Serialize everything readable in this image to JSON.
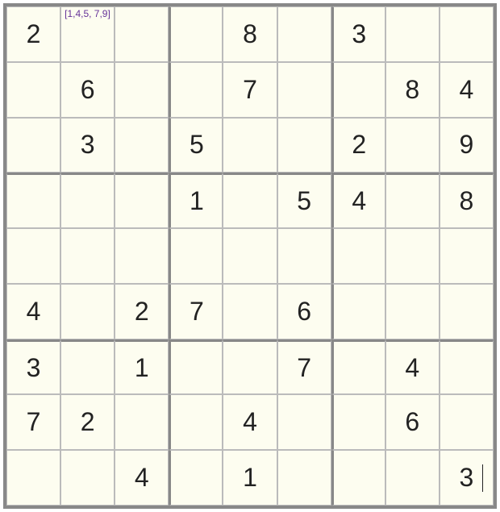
{
  "chart_data": {
    "type": "table",
    "title": "Sudoku Puzzle",
    "grid_size": 9,
    "box_size": 3,
    "rows": [
      [
        {
          "v": "2"
        },
        {
          "hint": "[1,4,5,\n7,9]"
        },
        {
          "v": ""
        },
        {
          "v": ""
        },
        {
          "v": "8"
        },
        {
          "v": ""
        },
        {
          "v": "3"
        },
        {
          "v": ""
        },
        {
          "v": ""
        }
      ],
      [
        {
          "v": ""
        },
        {
          "v": "6"
        },
        {
          "v": ""
        },
        {
          "v": ""
        },
        {
          "v": "7"
        },
        {
          "v": ""
        },
        {
          "v": ""
        },
        {
          "v": "8"
        },
        {
          "v": "4"
        }
      ],
      [
        {
          "v": ""
        },
        {
          "v": "3"
        },
        {
          "v": ""
        },
        {
          "v": "5"
        },
        {
          "v": ""
        },
        {
          "v": ""
        },
        {
          "v": "2"
        },
        {
          "v": ""
        },
        {
          "v": "9"
        }
      ],
      [
        {
          "v": ""
        },
        {
          "v": ""
        },
        {
          "v": ""
        },
        {
          "v": "1"
        },
        {
          "v": ""
        },
        {
          "v": "5"
        },
        {
          "v": "4"
        },
        {
          "v": ""
        },
        {
          "v": "8"
        }
      ],
      [
        {
          "v": ""
        },
        {
          "v": ""
        },
        {
          "v": ""
        },
        {
          "v": ""
        },
        {
          "v": ""
        },
        {
          "v": ""
        },
        {
          "v": ""
        },
        {
          "v": ""
        },
        {
          "v": ""
        }
      ],
      [
        {
          "v": "4"
        },
        {
          "v": ""
        },
        {
          "v": "2"
        },
        {
          "v": "7"
        },
        {
          "v": ""
        },
        {
          "v": "6"
        },
        {
          "v": ""
        },
        {
          "v": ""
        },
        {
          "v": ""
        }
      ],
      [
        {
          "v": "3"
        },
        {
          "v": ""
        },
        {
          "v": "1"
        },
        {
          "v": ""
        },
        {
          "v": ""
        },
        {
          "v": "7"
        },
        {
          "v": ""
        },
        {
          "v": "4"
        },
        {
          "v": ""
        }
      ],
      [
        {
          "v": "7"
        },
        {
          "v": "2"
        },
        {
          "v": ""
        },
        {
          "v": ""
        },
        {
          "v": "4"
        },
        {
          "v": ""
        },
        {
          "v": ""
        },
        {
          "v": "6"
        },
        {
          "v": ""
        }
      ],
      [
        {
          "v": ""
        },
        {
          "v": ""
        },
        {
          "v": "4"
        },
        {
          "v": ""
        },
        {
          "v": "1"
        },
        {
          "v": ""
        },
        {
          "v": ""
        },
        {
          "v": ""
        },
        {
          "v": "3",
          "cursor": true
        }
      ]
    ]
  }
}
